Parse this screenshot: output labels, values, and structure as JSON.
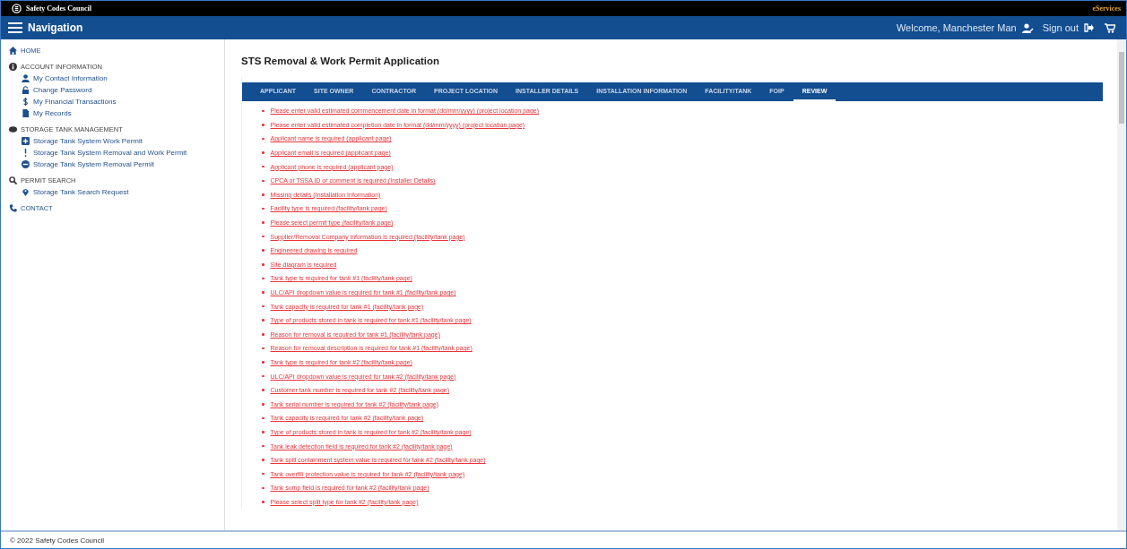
{
  "brand": {
    "name": "Safety Codes Council",
    "service": "eServices"
  },
  "navbar": {
    "title": "Navigation",
    "welcome": "Welcome, Manchester Man",
    "sign_out": "Sign out"
  },
  "sidebar": {
    "sections": [
      {
        "label": "HOME"
      },
      {
        "label": "ACCOUNT INFORMATION",
        "children": [
          "My Contact Information",
          "Change Password",
          "My Financial Transactions",
          "My Records"
        ]
      },
      {
        "label": "STORAGE TANK MANAGEMENT",
        "children": [
          "Storage Tank System Work Permit",
          "Storage Tank System Removal and Work Permit",
          "Storage Tank System Removal Permit"
        ]
      },
      {
        "label": "PERMIT SEARCH",
        "children": [
          "Storage Tank Search Request"
        ]
      },
      {
        "label": "CONTACT"
      }
    ]
  },
  "page_title": "STS Removal & Work Permit Application",
  "tabs": [
    {
      "label": "APPLICANT",
      "selected": false
    },
    {
      "label": "SITE OWNER",
      "selected": false
    },
    {
      "label": "CONTRACTOR",
      "selected": false
    },
    {
      "label": "PROJECT LOCATION",
      "selected": false
    },
    {
      "label": "INSTALLER DETAILS",
      "selected": false
    },
    {
      "label": "INSTALLATION INFORMATION",
      "selected": false
    },
    {
      "label": "FACILITY/TANK",
      "selected": false
    },
    {
      "label": "FOIP",
      "selected": false
    },
    {
      "label": "REVIEW",
      "selected": true
    }
  ],
  "errors": [
    "Please enter valid estimated commencement date in format (dd/mm/yyyy) (project location page)",
    "Please enter valid estimated completion date in format (dd/mm/yyyy) (project location page)",
    "Applicant name is required (applicant page)",
    "Applicant email is required (applicant page)",
    "Applicant phone is required (applicant page)",
    "CPCA or TSSA ID or comment is required (Installer Details)",
    "Missing details (Installation Information)",
    "Facility type is required (facility/tank page)",
    "Please select permit type (facility/tank page)",
    "Supplier/Removal Company information is required (facility/tank page)",
    "Engineered drawing is required",
    "Site diagram is required",
    "Tank type is required for tank #1 (facility/tank page)",
    "ULC/API dropdown value is required for tank #1 (facility/tank page)",
    "Tank capacity is required for tank #1 (facility/tank page)",
    "Type of products stored in tank is required for tank #1 (facility/tank page)",
    "Reason for removal is required for tank #1 (facility/tank page)",
    "Reason for removal description is required for tank #1 (facility/tank page)",
    "Tank type is required for tank #2 (facility/tank page)",
    "ULC/API dropdown value is required for tank #2 (facility/tank page)",
    "Customer tank number is required for tank #2 (facility/tank page)",
    "Tank serial number is required for tank #2 (facility/tank page)",
    "Tank capacity is required for tank #2 (facility/tank page)",
    "Type of products stored in tank is required for tank #2 (facility/tank page)",
    "Tank leak detection field is required for tank #2 (facility/tank page)",
    "Tank spill containment system value is required for tank #2 (facility/tank page)",
    "Tank overfill protection value is required for tank #2 (facility/tank page)",
    "Tank sump field is required for tank #2 (facility/tank page)",
    "Please select split type for tank #2 (facility/tank page)"
  ],
  "footer": "© 2022 Safety Codes Council"
}
